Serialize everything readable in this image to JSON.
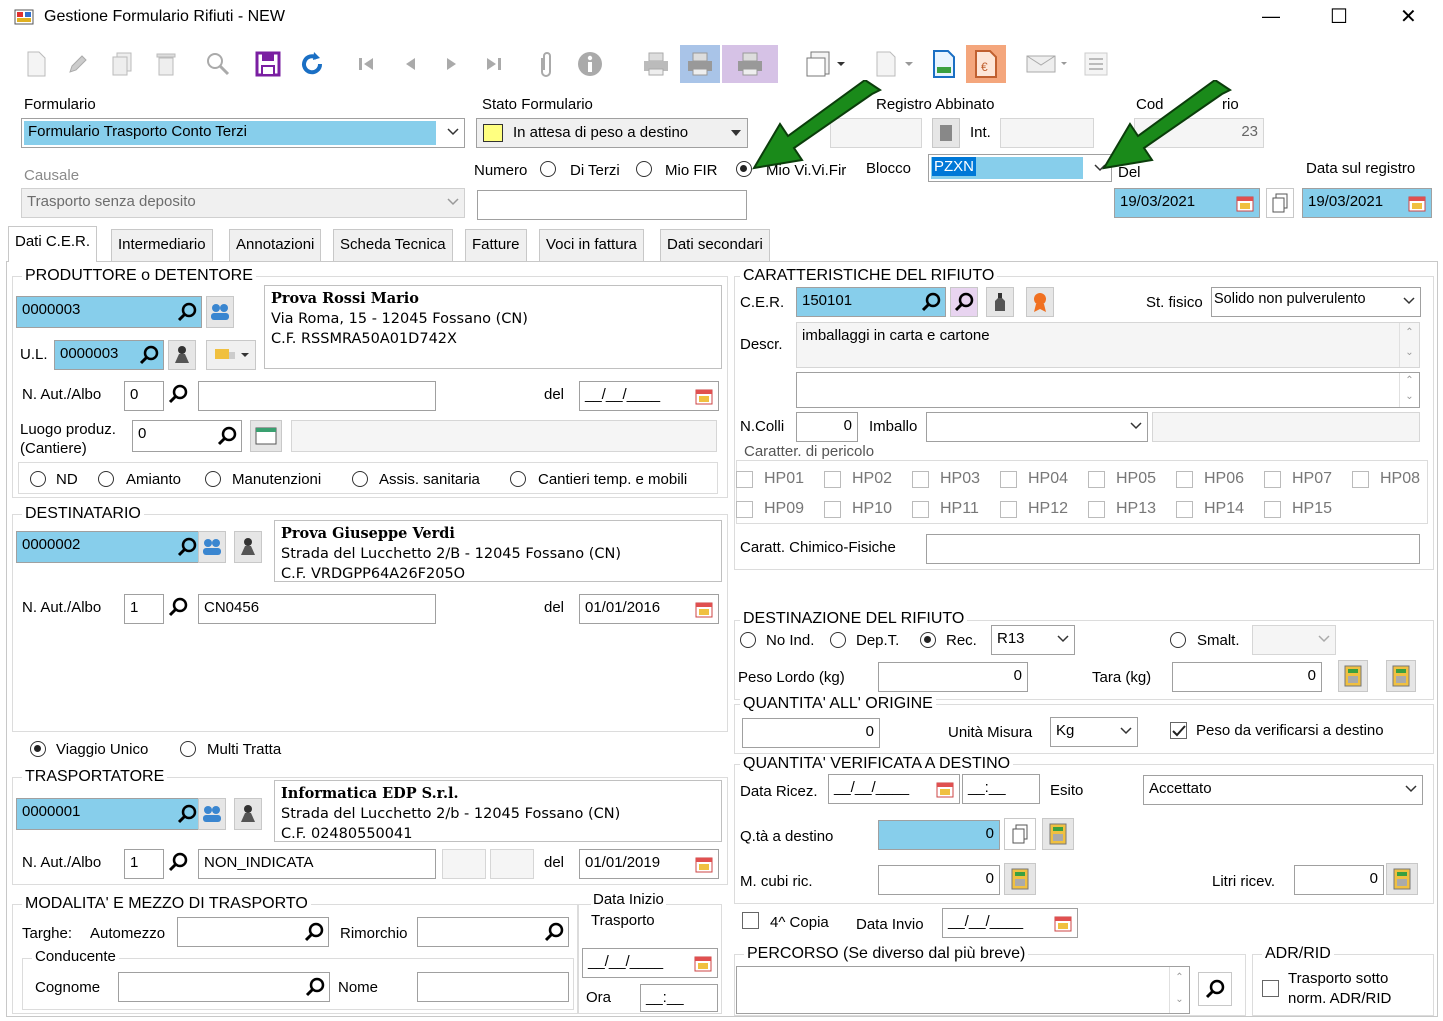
{
  "window": {
    "title": "Gestione Formulario Rifiuti - NEW",
    "min": "—",
    "max": "☐",
    "close": "✕"
  },
  "header": {
    "formulario_label": "Formulario",
    "formulario_value": "Formulario Trasporto Conto Terzi",
    "stato_label": "Stato Formulario",
    "stato_value": "In attesa di peso a destino",
    "registro_label": "Registro Abbinato",
    "int_label": "Int.",
    "cod_label": "Cod",
    "cod_label_tail": "rio",
    "cod_value": "23",
    "causale_label": "Causale",
    "causale_value": "Trasporto senza deposito",
    "numero_label": "Numero",
    "radio_terzi": "Di Terzi",
    "radio_mio": "Mio FIR",
    "radio_vivifir": "Mio Vi.Vi.Fir",
    "blocco_label": "Blocco",
    "blocco_value": "PZXN",
    "del_label": "Del",
    "del_value": "19/03/2021",
    "data_registro_label": "Data sul registro",
    "data_registro_value": "19/03/2021"
  },
  "tabs": [
    "Dati C.E.R.",
    "Intermediario",
    "Annotazioni",
    "Scheda Tecnica",
    "Fatture",
    "Voci in fattura",
    "Dati secondari"
  ],
  "produttore": {
    "title": "PRODUTTORE o DETENTORE",
    "code": "0000003",
    "ul_label": "U.L.",
    "ul_code": "0000003",
    "name": "Prova Rossi Mario",
    "address": "Via Roma, 15 - 12045 Fossano (CN)",
    "cf": "C.F. RSSMRA50A01D742X",
    "aut_label": "N. Aut./Albo",
    "aut_num": "0",
    "del_label": "del",
    "del_value": "__/__/____",
    "luogo_label": "Luogo produz.",
    "luogo_label2": "(Cantiere)",
    "luogo_value": "0",
    "radios": [
      "ND",
      "Amianto",
      "Manutenzioni",
      "Assis. sanitaria",
      "Cantieri temp. e mobili"
    ]
  },
  "destinatario": {
    "title": "DESTINATARIO",
    "code": "0000002",
    "name": "Prova Giuseppe Verdi",
    "address": "Strada del Lucchetto 2/B - 12045 Fossano (CN)",
    "cf": "C.F. VRDGPP64A26F205O",
    "aut_label": "N. Aut./Albo",
    "aut_num": "1",
    "aut_value": "CN0456",
    "del_label": "del",
    "del_value": "01/01/2016"
  },
  "viaggio": {
    "unico": "Viaggio Unico",
    "multi": "Multi Tratta"
  },
  "trasportatore": {
    "title": "TRASPORTATORE",
    "code": "0000001",
    "name": "Informatica EDP S.r.l.",
    "address": "Strada del Lucchetto 2/b - 12045 Fossano (CN)",
    "cf": "C.F. 02480550041",
    "aut_label": "N. Aut./Albo",
    "aut_num": "1",
    "aut_value": "NON_INDICATA",
    "del_label": "del",
    "del_value": "01/01/2019"
  },
  "modalita": {
    "title": "MODALITA' E MEZZO DI TRASPORTO",
    "targhe_label": "Targhe:",
    "automezzo_label": "Automezzo",
    "rimorchio_label": "Rimorchio",
    "conducente_label": "Conducente",
    "cognome_label": "Cognome",
    "nome_label": "Nome",
    "data_inizio_label": "Data Inizio",
    "trasporto_label": "Trasporto",
    "data_value": "__/__/____",
    "ora_label": "Ora",
    "ora_value": "__:__"
  },
  "caratteristiche": {
    "title": "CARATTERISTICHE DEL RIFIUTO",
    "cer_label": "C.E.R.",
    "cer_value": "150101",
    "stato_fisico_label": "St. fisico",
    "stato_fisico_value": "Solido non pulverulento",
    "descr_label": "Descr.",
    "descr_value": "imballaggi in carta e cartone",
    "ncolli_label": "N.Colli",
    "ncolli_value": "0",
    "imballo_label": "Imballo",
    "pericolo_label": "Caratter. di pericolo",
    "hp_row1": [
      "HP01",
      "HP02",
      "HP03",
      "HP04",
      "HP05",
      "HP06",
      "HP07",
      "HP08"
    ],
    "hp_row2": [
      "HP09",
      "HP10",
      "HP11",
      "HP12",
      "HP13",
      "HP14",
      "HP15"
    ],
    "chimico_label": "Caratt. Chimico-Fisiche"
  },
  "destinazione": {
    "title": "DESTINAZIONE DEL RIFIUTO",
    "no_ind": "No Ind.",
    "dep": "Dep.T.",
    "rec": "Rec.",
    "rec_value": "R13",
    "smalt": "Smalt.",
    "peso_lordo_label": "Peso Lordo (kg)",
    "peso_lordo_value": "0",
    "tara_label": "Tara (kg)",
    "tara_value": "0"
  },
  "quantita": {
    "title": "QUANTITA'  ALL' ORIGINE",
    "value": "0",
    "unita_label": "Unità Misura",
    "unita_value": "Kg",
    "verificarsi_label": "Peso da verificarsi a destino"
  },
  "verificata": {
    "title": "QUANTITA' VERIFICATA A DESTINO",
    "data_ricez_label": "Data Ricez.",
    "data_value": "__/__/____",
    "ora_value": "__:__",
    "esito_label": "Esito",
    "esito_value": "Accettato",
    "qta_label": "Q.tà a destino",
    "qta_value": "0",
    "mcubi_label": "M. cubi ric.",
    "mcubi_value": "0",
    "litri_label": "Litri ricev.",
    "litri_value": "0"
  },
  "copia": {
    "label": "4^ Copia",
    "data_invio_label": "Data Invio",
    "data_invio_value": "__/__/____"
  },
  "percorso": {
    "title": "PERCORSO (Se diverso dal più breve)"
  },
  "adr": {
    "title": "ADR/RID",
    "label1": "Trasporto sotto",
    "label2": "norm. ADR/RID"
  },
  "colors": {
    "field_blue": "#87ceeb",
    "arrow_green": "#1a8a1a",
    "selection_blue": "#0078d7"
  }
}
